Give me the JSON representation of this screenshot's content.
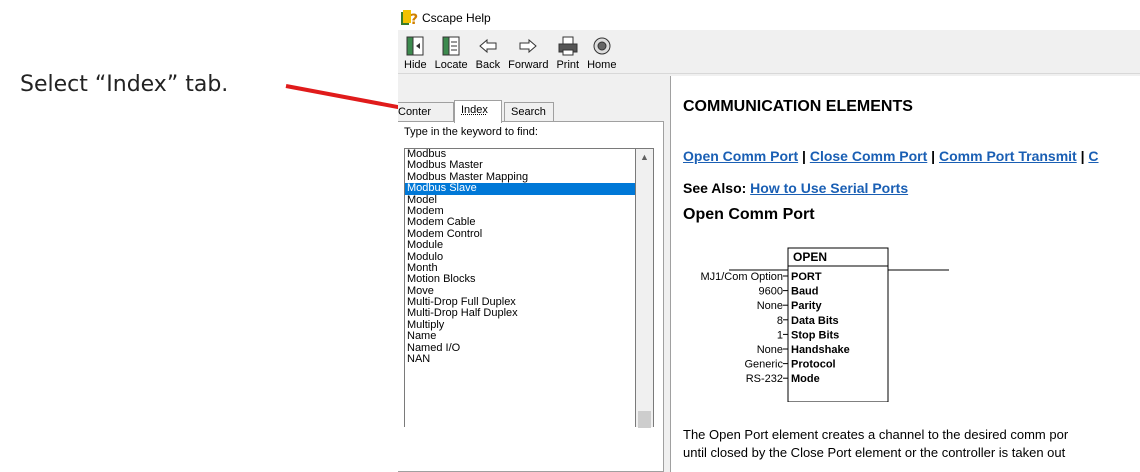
{
  "annotation": {
    "text": "Select “Index” tab."
  },
  "window": {
    "title": "Cscape Help"
  },
  "toolbar": {
    "buttons": [
      {
        "label": "Hide",
        "icon": "hide-icon"
      },
      {
        "label": "Locate",
        "icon": "locate-icon"
      },
      {
        "label": "Back",
        "icon": "back-arrow-icon"
      },
      {
        "label": "Forward",
        "icon": "forward-arrow-icon"
      },
      {
        "label": "Print",
        "icon": "printer-icon"
      },
      {
        "label": "Home",
        "icon": "home-icon"
      }
    ]
  },
  "tabs": {
    "contents": "Conter",
    "index": "Index",
    "search": "Search"
  },
  "index": {
    "label": "Type in the keyword to find:",
    "value": "Modbus Slave",
    "items": [
      "Modbus",
      "Modbus Master",
      "Modbus Master Mapping",
      "Modbus Slave",
      "Model",
      "Modem",
      "Modem Cable",
      "Modem Control",
      "Module",
      "Modulo",
      "Month",
      "Motion Blocks",
      "Move",
      "Multi-Drop Full Duplex",
      "Multi-Drop Half Duplex",
      "Multiply",
      "Name",
      "Named I/O",
      "NAN"
    ],
    "selected": "Modbus Slave"
  },
  "content": {
    "heading": "COMMUNICATION ELEMENTS",
    "links": [
      "Open Comm Port",
      "Close Comm Port",
      "Comm Port Transmit",
      "C"
    ],
    "link_separator": " | ",
    "see_also_label": "See Also:",
    "see_also_link": "How to Use Serial Ports",
    "subheading": "Open Comm Port",
    "block_title": "OPEN",
    "block_rows": [
      {
        "input": "MJ1/Com Option",
        "name": "PORT"
      },
      {
        "input": "9600",
        "name": "Baud"
      },
      {
        "input": "None",
        "name": "Parity"
      },
      {
        "input": "8",
        "name": "Data Bits"
      },
      {
        "input": "1",
        "name": "Stop Bits"
      },
      {
        "input": "None",
        "name": "Handshake"
      },
      {
        "input": "Generic",
        "name": "Protocol"
      },
      {
        "input": "RS-232",
        "name": "Mode"
      }
    ],
    "para_line1": "The Open Port element creates a channel to the desired comm por",
    "para_line2": "until closed by the Close Port element or the controller is taken out"
  },
  "colors": {
    "accent_red": "#e01b1b",
    "link_blue": "#1a5fb4",
    "selection": "#0078d7"
  }
}
